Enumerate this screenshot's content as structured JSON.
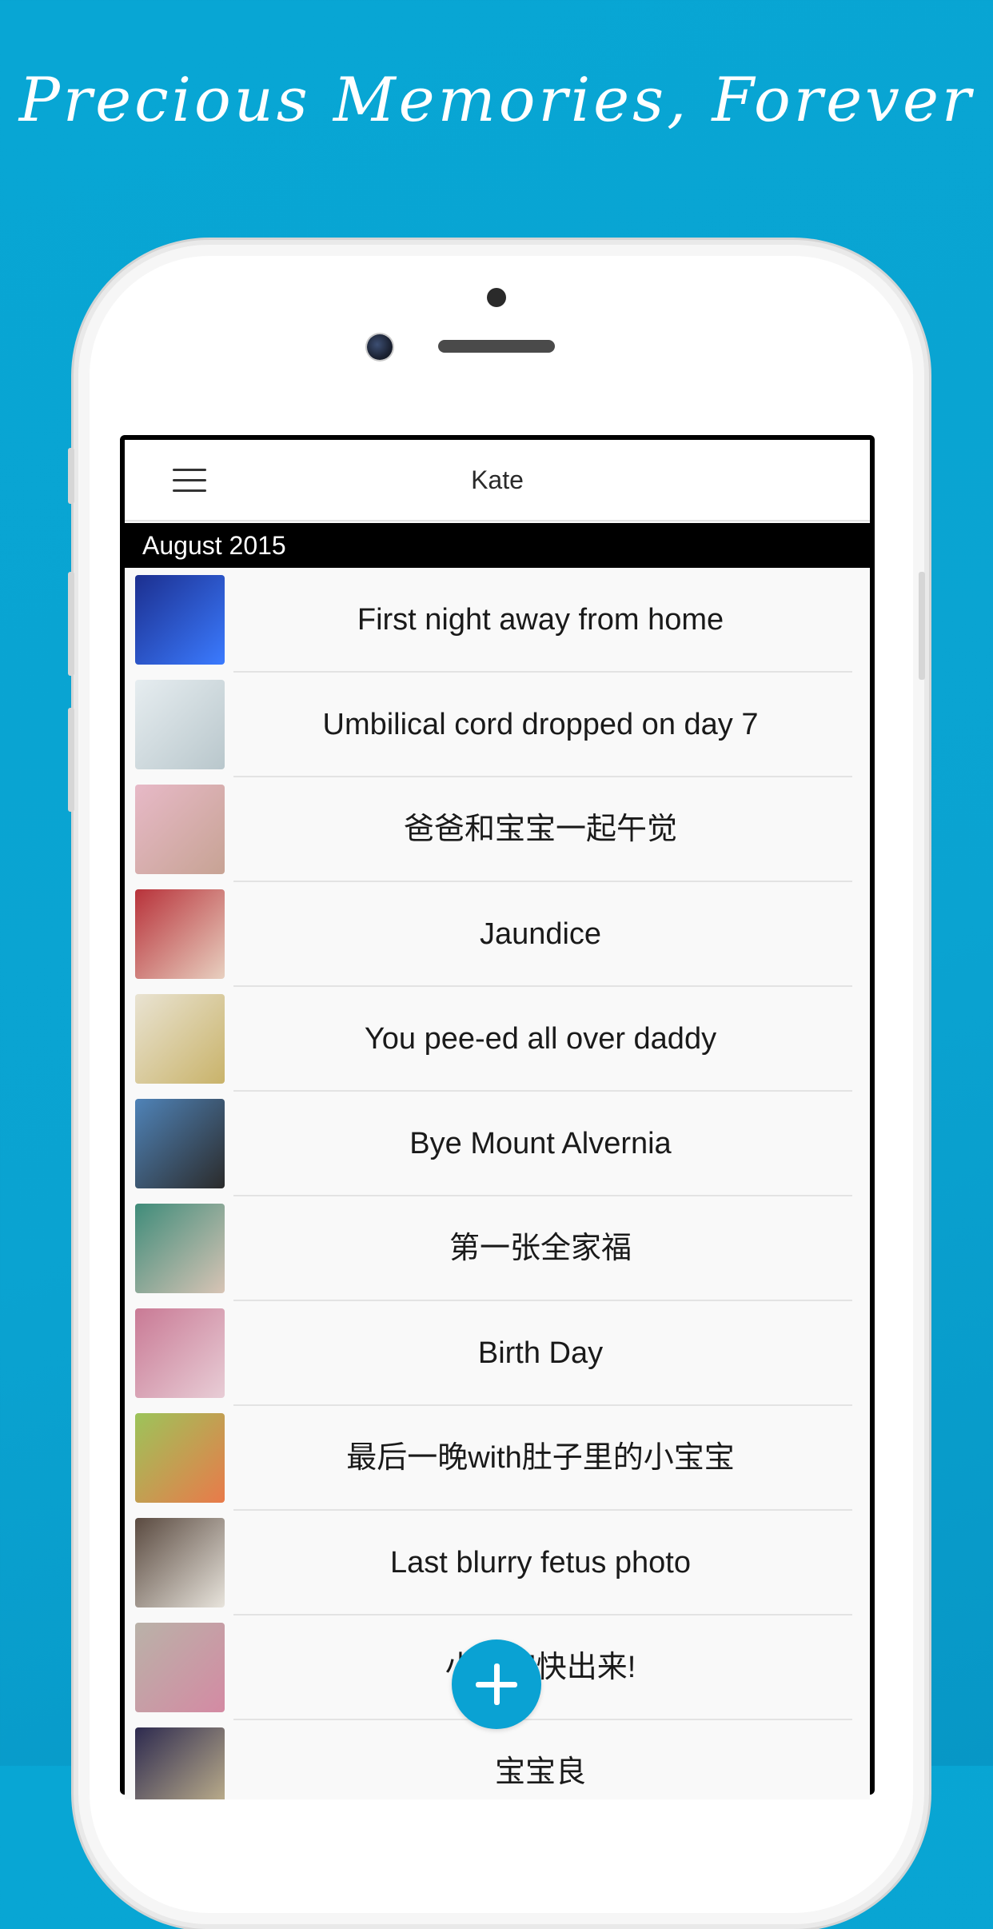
{
  "headline": "Precious Memories, Forever",
  "app": {
    "title": "Kate",
    "menu_icon": "hamburger-menu-icon",
    "section": "August 2015",
    "entries": [
      {
        "title": "First night away from home",
        "thumb_colors": [
          "#1c2f8f",
          "#3b7bff"
        ]
      },
      {
        "title": "Umbilical cord dropped on day 7",
        "thumb_colors": [
          "#e6edf0",
          "#b9c7cc"
        ]
      },
      {
        "title": "爸爸和宝宝一起午觉",
        "thumb_colors": [
          "#e7b9c7",
          "#c7a394"
        ]
      },
      {
        "title": "Jaundice",
        "thumb_colors": [
          "#b8323a",
          "#e8d0c0"
        ]
      },
      {
        "title": "You pee-ed all over daddy",
        "thumb_colors": [
          "#e9e3d2",
          "#c9b36a"
        ]
      },
      {
        "title": "Bye Mount Alvernia",
        "thumb_colors": [
          "#4f83b8",
          "#2b2b2b"
        ]
      },
      {
        "title": "第一张全家福",
        "thumb_colors": [
          "#3f8c7a",
          "#d8c4b5"
        ]
      },
      {
        "title": "Birth Day",
        "thumb_colors": [
          "#c97a95",
          "#e8cdd6"
        ]
      },
      {
        "title": "最后一晚with肚子里的小宝宝",
        "thumb_colors": [
          "#9cc45a",
          "#e97a4a"
        ]
      },
      {
        "title": "Last blurry fetus photo",
        "thumb_colors": [
          "#5a4a40",
          "#e8e4dc"
        ]
      },
      {
        "title": "小宝宝快出来!",
        "thumb_colors": [
          "#b9b2a8",
          "#d48aa3"
        ]
      },
      {
        "title": "宝宝良",
        "thumb_colors": [
          "#2d2a4f",
          "#c7b890"
        ]
      }
    ]
  },
  "fab": {
    "icon": "plus-icon"
  }
}
